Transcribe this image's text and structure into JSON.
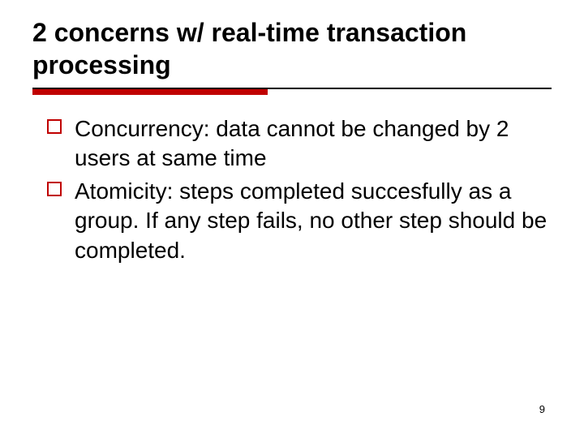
{
  "slide": {
    "title": "2 concerns w/ real-time transaction processing",
    "bullets": [
      {
        "text": "Concurrency: data cannot be changed by 2 users at same time"
      },
      {
        "text": "Atomicity: steps completed succesfully as a group. If any step fails, no other step should be completed."
      }
    ],
    "page_number": "9"
  }
}
